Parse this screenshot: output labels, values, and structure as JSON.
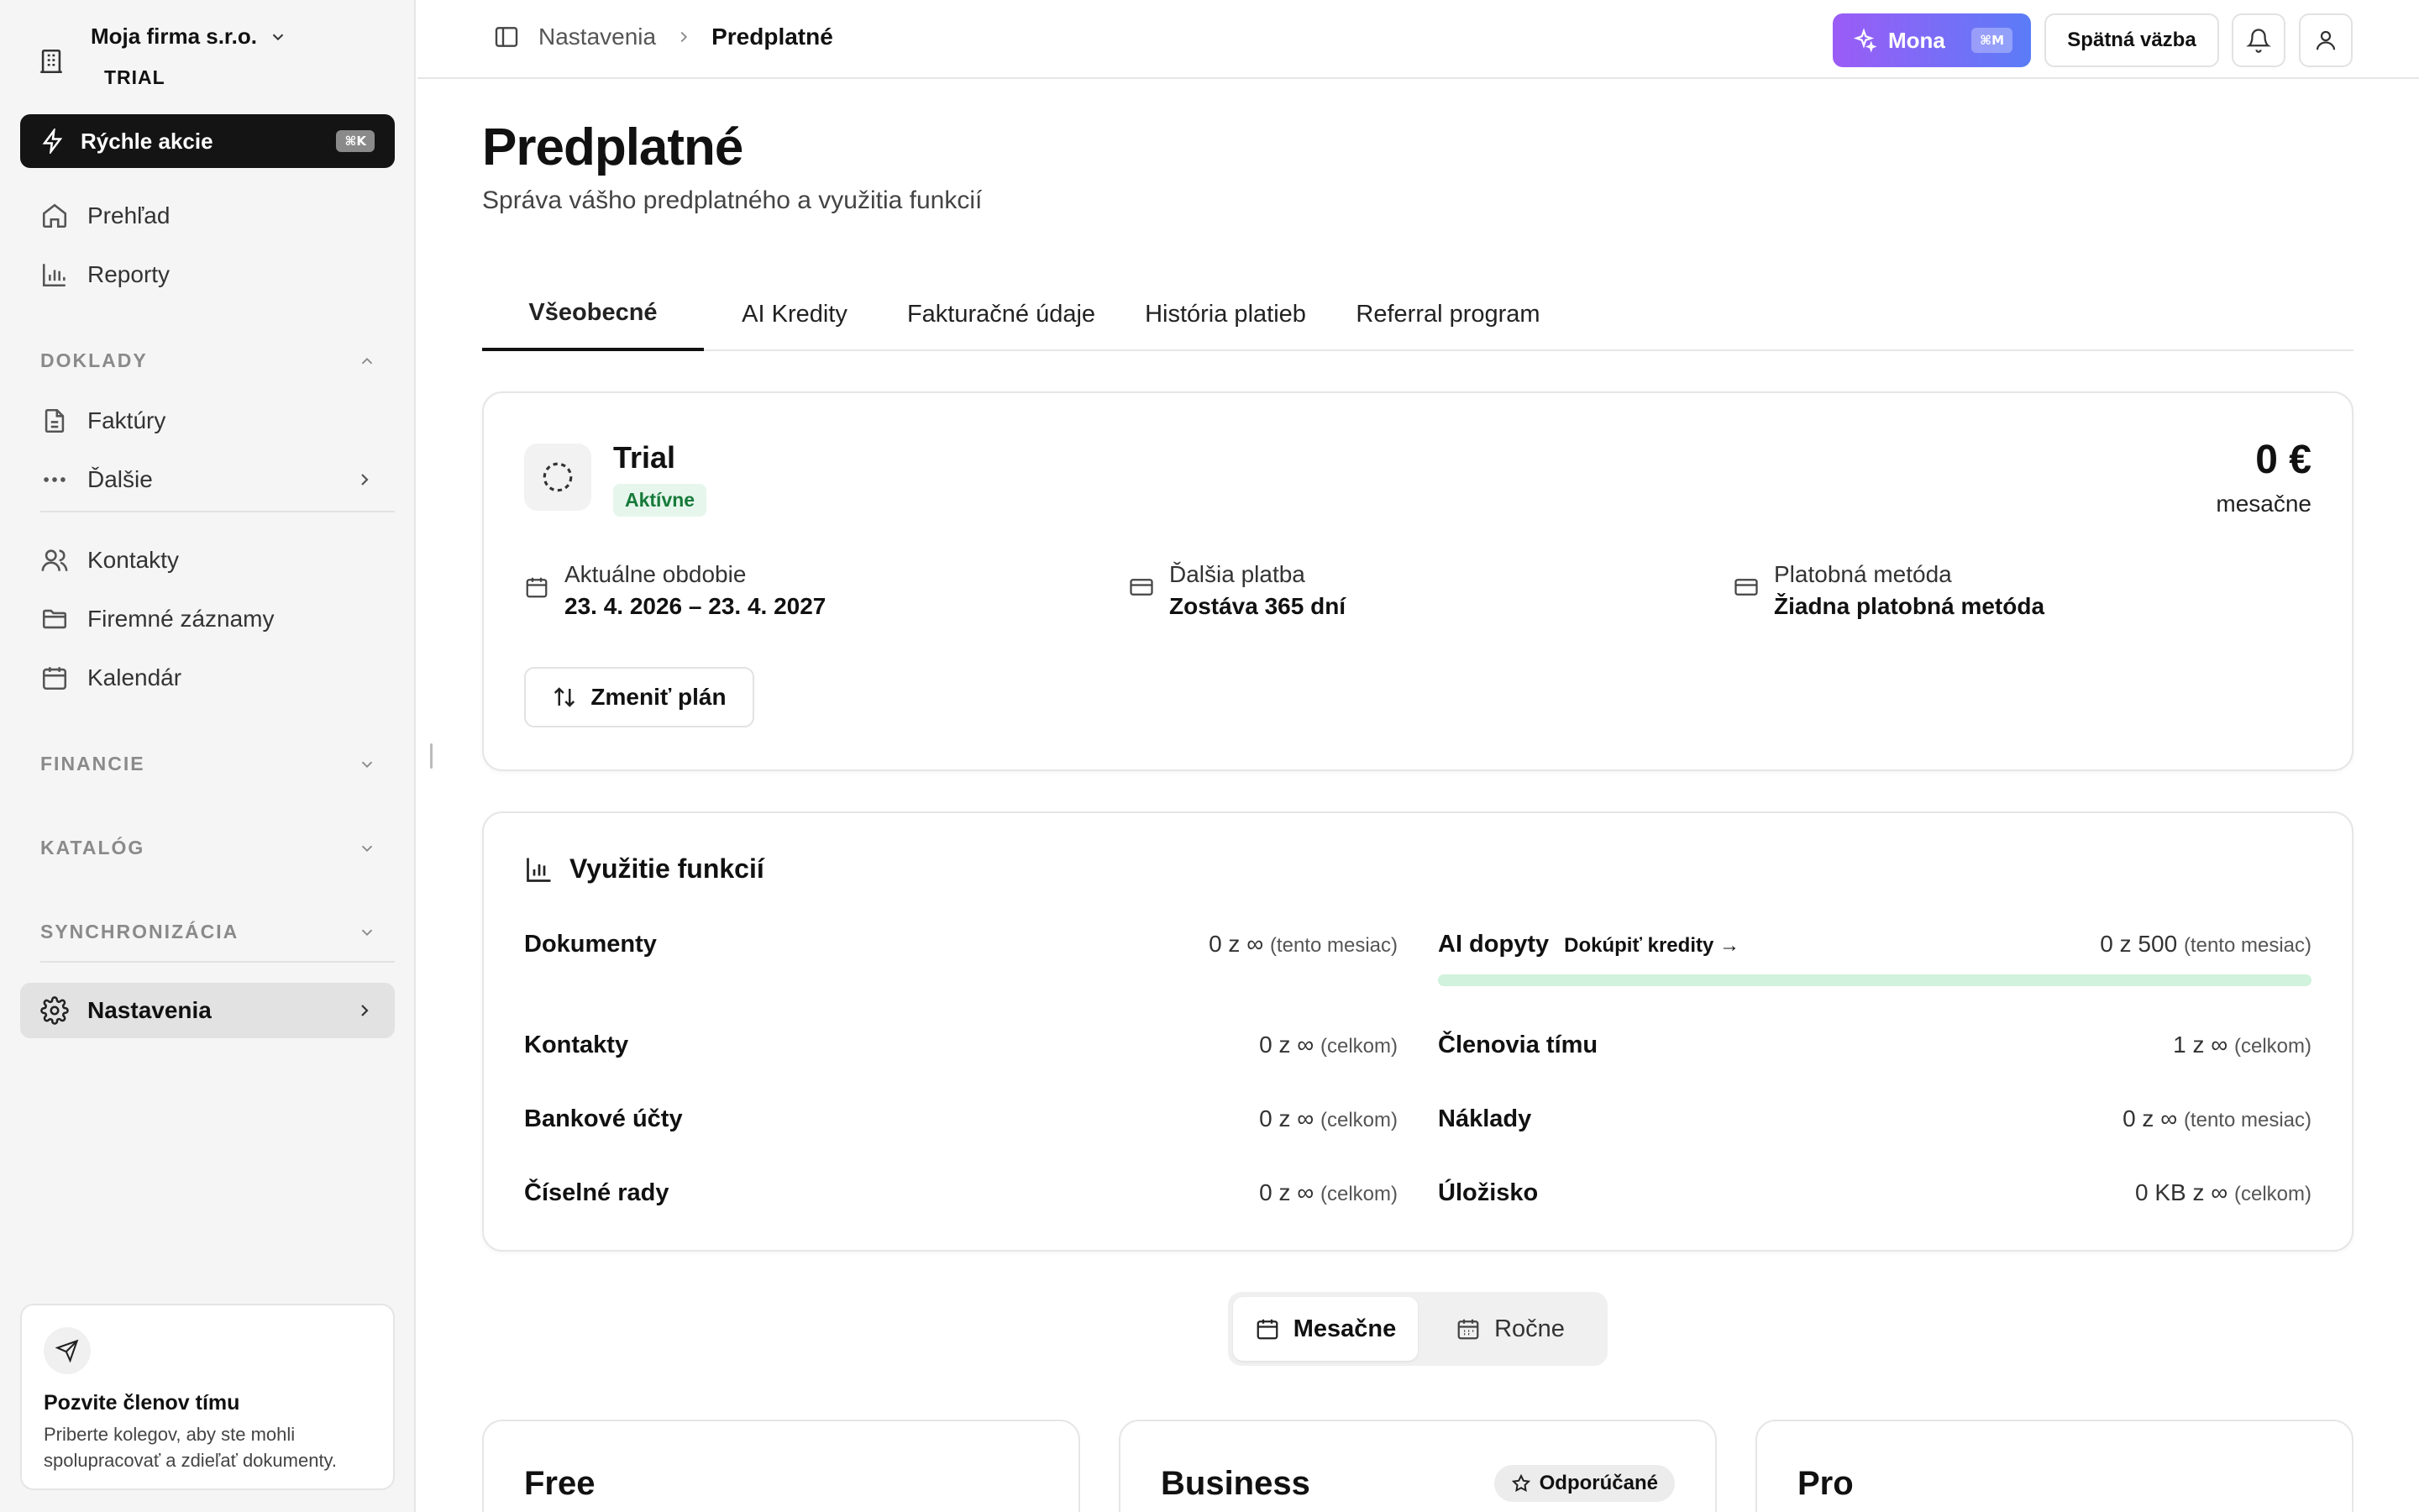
{
  "sidebar": {
    "company": "Moja firma s.r.o.",
    "plan_tag": "TRIAL",
    "quick_actions": {
      "label": "Rýchle akcie",
      "shortcut": "⌘K"
    },
    "top_items": [
      {
        "label": "Prehľad",
        "icon": "home-icon"
      },
      {
        "label": "Reporty",
        "icon": "bar-chart-icon"
      }
    ],
    "sections": {
      "doklady": "DOKLADY",
      "financie": "FINANCIE",
      "katalog": "KATALÓG",
      "synchronizacia": "SYNCHRONIZÁCIA"
    },
    "doklady_items": [
      {
        "label": "Faktúry",
        "icon": "document-icon"
      },
      {
        "label": "Ďalšie",
        "icon": "more-dots-icon"
      }
    ],
    "main_items": [
      {
        "label": "Kontakty",
        "icon": "users-icon"
      },
      {
        "label": "Firemné záznamy",
        "icon": "folder-icon"
      },
      {
        "label": "Kalendár",
        "icon": "calendar-icon"
      }
    ],
    "settings": {
      "label": "Nastavenia",
      "icon": "gear-icon"
    },
    "invite": {
      "title": "Pozvite členov tímu",
      "text": "Priberte kolegov, aby ste mohli spolupracovať a zdieľať dokumenty."
    }
  },
  "topbar": {
    "breadcrumb": [
      "Nastavenia",
      "Predplatné"
    ],
    "mona_label": "Mona",
    "mona_shortcut": "⌘M",
    "feedback_label": "Spätná väzba"
  },
  "page": {
    "title": "Predplatné",
    "subtitle": "Správa vášho predplatného a využitia funkcií",
    "tabs": [
      "Všeobecné",
      "AI Kredity",
      "Fakturačné údaje",
      "História platieb",
      "Referral program"
    ],
    "active_tab": "Všeobecné"
  },
  "plan": {
    "name": "Trial",
    "status": "Aktívne",
    "price": "0 €",
    "period": "mesačne",
    "current_period_label": "Aktuálne obdobie",
    "current_period_value": "23. 4. 2026 – 23. 4. 2027",
    "next_payment_label": "Ďalšia platba",
    "next_payment_value": "Zostáva 365 dní",
    "payment_method_label": "Platobná metóda",
    "payment_method_value": "Žiadna platobná metóda",
    "change_button": "Zmeniť plán"
  },
  "usage": {
    "title": "Využitie funkcií",
    "buy_credits": "Dokúpiť kredity →",
    "ai_progress": 0,
    "left": [
      {
        "name": "Dokumenty",
        "value": "0 z ∞",
        "scope": "(tento mesiac)"
      },
      {
        "name": "Kontakty",
        "value": "0 z ∞",
        "scope": "(celkom)"
      },
      {
        "name": "Bankové účty",
        "value": "0 z ∞",
        "scope": "(celkom)"
      },
      {
        "name": "Číselné rady",
        "value": "0 z ∞",
        "scope": "(celkom)"
      }
    ],
    "right": [
      {
        "name": "AI dopyty",
        "value": "0 z 500",
        "scope": "(tento mesiac)"
      },
      {
        "name": "Členovia tímu",
        "value": "1 z ∞",
        "scope": "(celkom)"
      },
      {
        "name": "Náklady",
        "value": "0 z ∞",
        "scope": "(tento mesiac)"
      },
      {
        "name": "Úložisko",
        "value": "0 KB z ∞",
        "scope": "(celkom)"
      }
    ]
  },
  "billing_toggle": {
    "monthly": "Mesačne",
    "yearly": "Ročne",
    "selected": "Mesačne"
  },
  "plans": [
    {
      "name": "Free"
    },
    {
      "name": "Business",
      "badge": "Odporúčané"
    },
    {
      "name": "Pro"
    }
  ],
  "colors": {
    "accent_green": "#22c55e",
    "mona_gradient_start": "#9b5cf6",
    "mona_gradient_end": "#5b7cf7"
  }
}
